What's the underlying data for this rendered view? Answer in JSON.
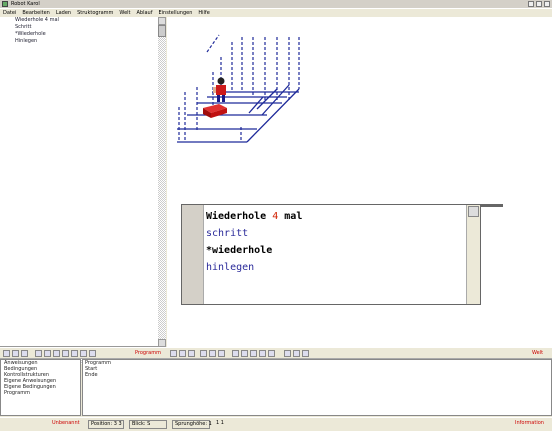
{
  "window": {
    "title": "Robot Karol"
  },
  "menu": [
    "Datei",
    "Bearbeiten",
    "Laden",
    "Struktogramm",
    "Welt",
    "Ablauf",
    "Einstellungen",
    "Hilfe"
  ],
  "tree": {
    "items": [
      "Wiederhole 4 mal",
      "Schritt",
      "*Wiederhole",
      "Hinlegen"
    ]
  },
  "editor": {
    "lines": [
      {
        "parts": [
          {
            "t": "Wiederhole ",
            "c": "kw"
          },
          {
            "t": "4",
            "c": "num"
          },
          {
            "t": " mal",
            "c": "kw"
          }
        ]
      },
      {
        "parts": [
          {
            "t": "schritt",
            "c": "cmd"
          }
        ]
      },
      {
        "parts": [
          {
            "t": "*wiederhole",
            "c": "kw"
          }
        ]
      },
      {
        "parts": [
          {
            "t": "hinlegen",
            "c": "cmd"
          }
        ]
      }
    ]
  },
  "toolbar": {
    "program_label": "Programm",
    "world_label": "Welt"
  },
  "bottom_left": {
    "items": [
      "Anweisungen",
      "Bedingungen",
      "Kontrollstrukturen",
      "Eigene Anweisungen",
      "Eigene Bedingungen",
      "Programm"
    ]
  },
  "bottom_right": {
    "lines": [
      "Programm",
      "Start",
      "Ende"
    ]
  },
  "status": {
    "left": "Unbenannt",
    "position": "Position: 3 3",
    "direction": "Blick: S",
    "height": "Sprunghöhe: 1",
    "x": "1 1",
    "right": "Information"
  },
  "colors": {
    "grid": "#1e2a9a",
    "robot_red": "#cc1a1a",
    "brick_red": "#c01010",
    "keyword": "#000000",
    "number": "#d02000",
    "command": "#2a2a9a"
  }
}
